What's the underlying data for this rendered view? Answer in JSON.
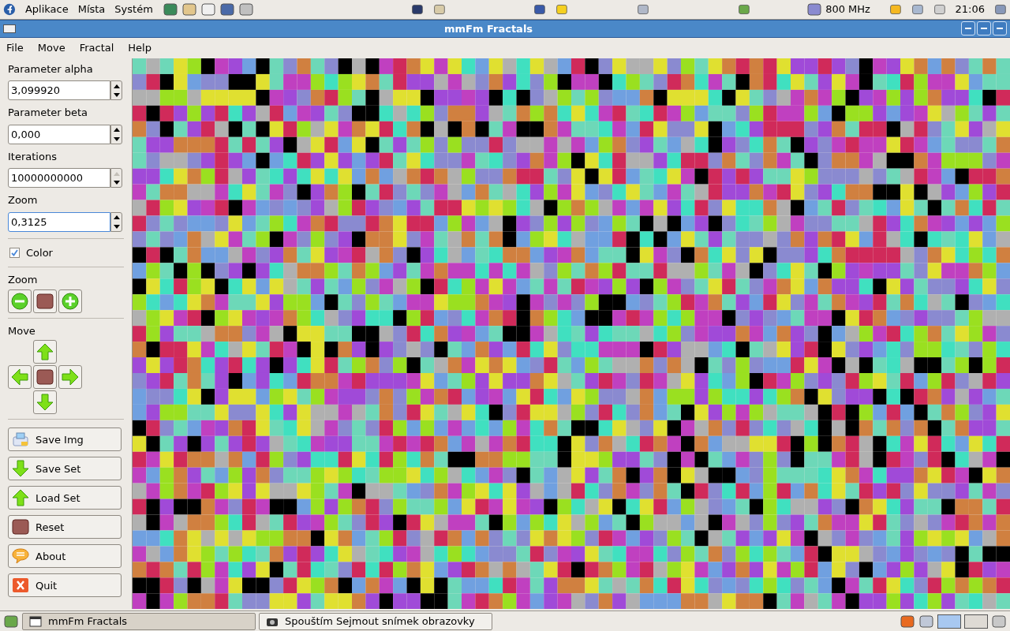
{
  "top_panel": {
    "menus": [
      "Aplikace",
      "Místa",
      "Systém"
    ],
    "cpu_freq": "800 MHz",
    "clock": "21:06"
  },
  "window": {
    "title": "mmFm Fractals"
  },
  "menu_bar": [
    "File",
    "Move",
    "Fractal",
    "Help"
  ],
  "sidebar": {
    "fields": [
      {
        "label": "Parameter alpha",
        "value": "3,099920",
        "focused": false,
        "up_disabled": false
      },
      {
        "label": "Parameter beta",
        "value": "0,000",
        "focused": false,
        "up_disabled": false
      },
      {
        "label": "Iterations",
        "value": "10000000000",
        "focused": false,
        "up_disabled": true
      },
      {
        "label": "Zoom",
        "value": "0,3125",
        "focused": true,
        "up_disabled": false
      }
    ],
    "color_checkbox": {
      "label": "Color",
      "checked": true
    },
    "zoom_label": "Zoom",
    "move_label": "Move",
    "buttons": [
      {
        "kind": "printer",
        "label": "Save Img"
      },
      {
        "kind": "down",
        "label": "Save Set"
      },
      {
        "kind": "up",
        "label": "Load Set"
      },
      {
        "kind": "stop",
        "label": "Reset"
      },
      {
        "kind": "bubble",
        "label": "About"
      },
      {
        "kind": "quit",
        "label": "Quit"
      }
    ]
  },
  "taskbar": {
    "tasks": [
      {
        "label": "mmFm Fractals",
        "selected": true,
        "kind": "window"
      },
      {
        "label": "Spouštím Sejmout snímek obrazovky",
        "selected": false,
        "kind": "camera"
      }
    ]
  }
}
